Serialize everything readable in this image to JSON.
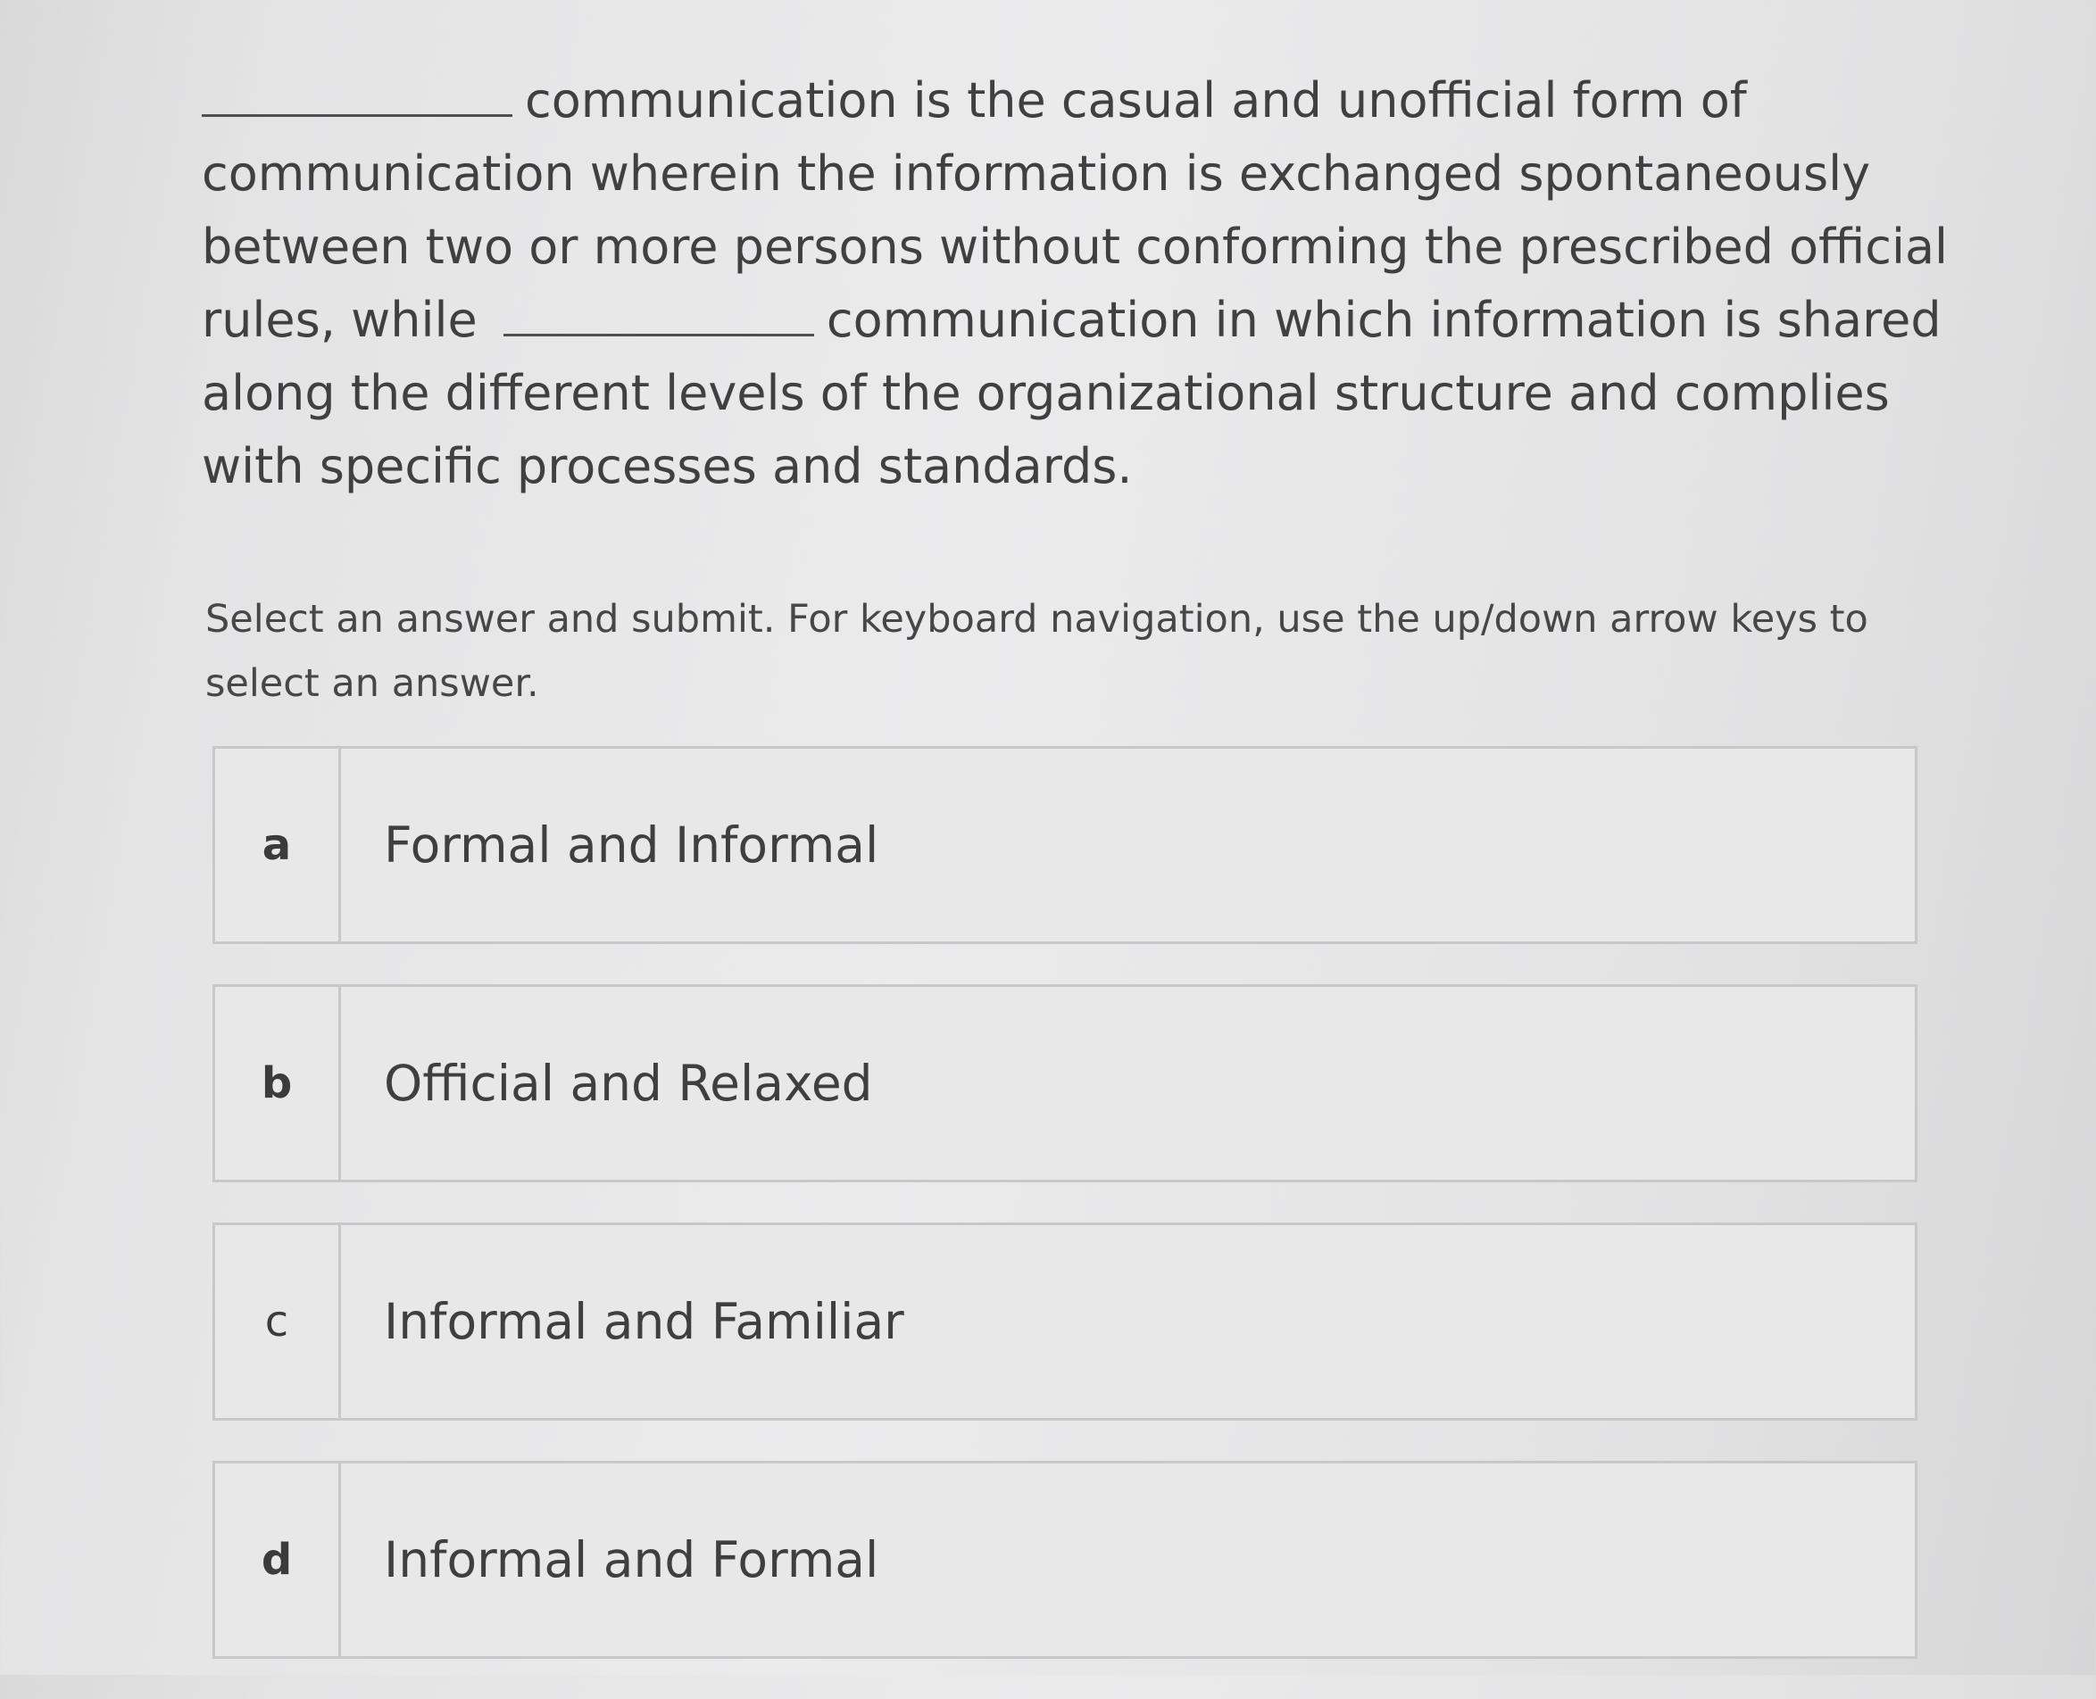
{
  "question": {
    "part1": "communication is the casual and unofficial form of communication wherein the information is exchanged spontaneously between two or more persons without conforming the prescribed official rules, while",
    "part2": "communication in which information is shared along the different levels of the organizational structure and complies with specific processes and standards."
  },
  "instructions": "Select an answer and submit. For keyboard navigation, use the up/down arrow keys to select an answer.",
  "options": [
    {
      "letter": "a",
      "text": "Formal and Informal"
    },
    {
      "letter": "b",
      "text": "Official and Relaxed"
    },
    {
      "letter": "c",
      "text": "Informal and Familiar"
    },
    {
      "letter": "d",
      "text": "Informal and Formal"
    }
  ]
}
